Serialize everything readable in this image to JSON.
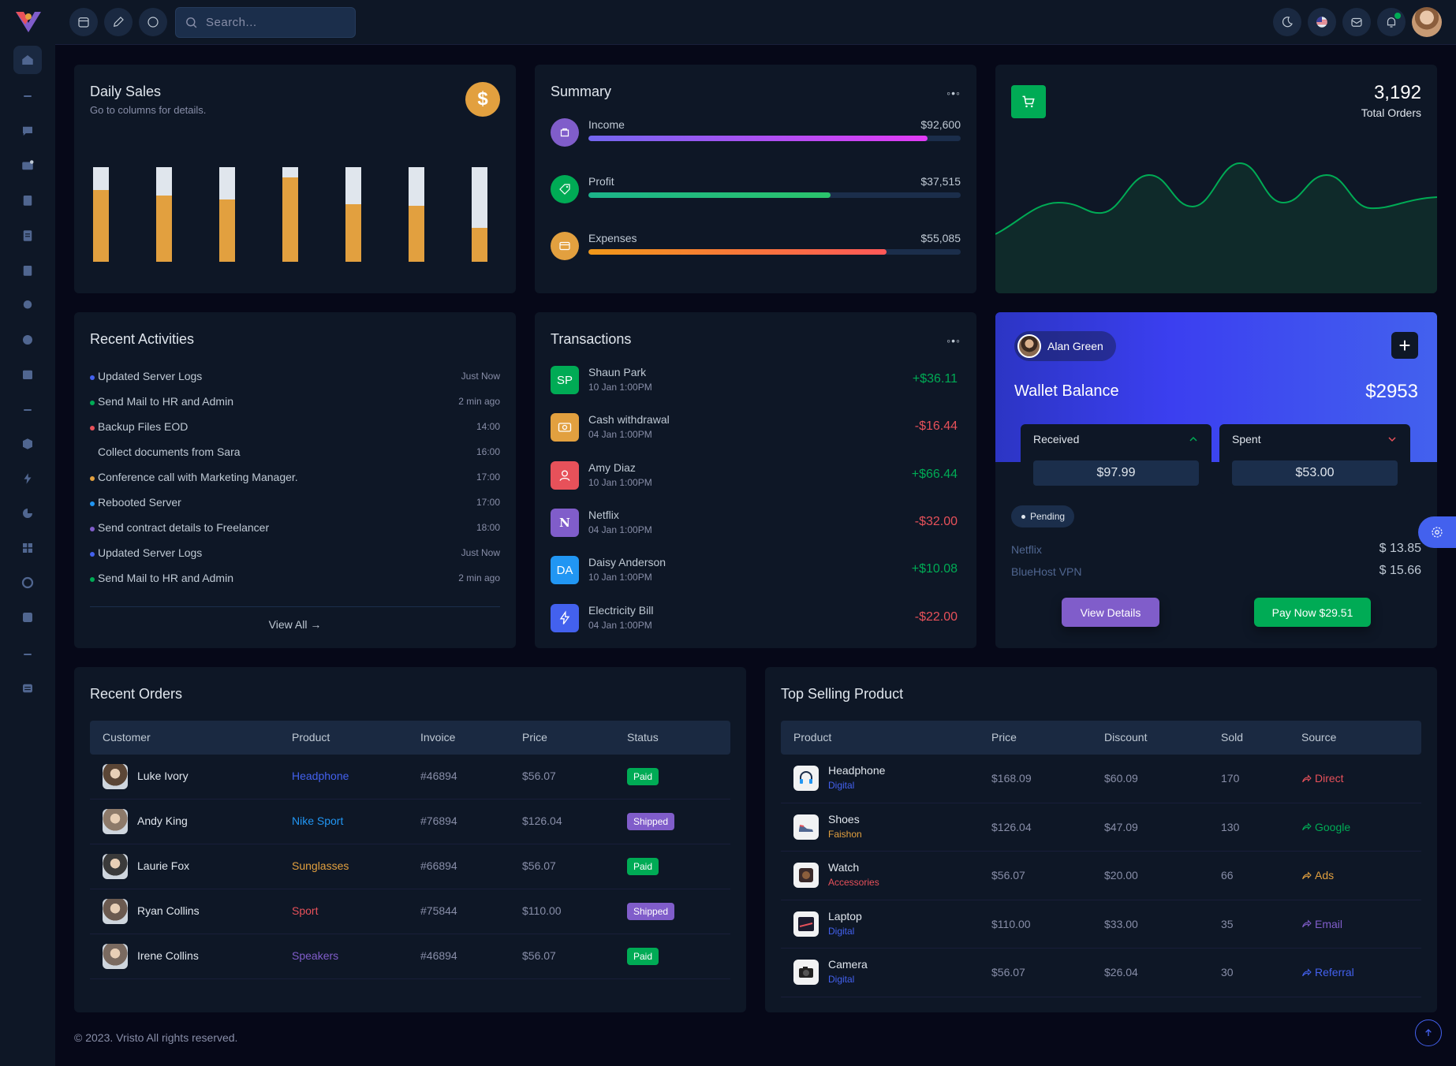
{
  "header": {
    "search_placeholder": "Search..."
  },
  "daily_sales": {
    "title": "Daily Sales",
    "subtitle": "Go to columns for details.",
    "icon_symbol": "$",
    "bars": [
      {
        "sales": 76,
        "last_week": 24
      },
      {
        "sales": 70,
        "last_week": 30
      },
      {
        "sales": 66,
        "last_week": 34
      },
      {
        "sales": 89,
        "last_week": 11
      },
      {
        "sales": 61,
        "last_week": 39
      },
      {
        "sales": 59,
        "last_week": 41
      },
      {
        "sales": 36,
        "last_week": 64
      }
    ],
    "colors": {
      "sales": "#e2a03f",
      "last_week": "#e0e6ed"
    }
  },
  "summary": {
    "title": "Summary",
    "items": [
      {
        "label": "Income",
        "value": "$92,600",
        "percent": 91,
        "icon": "income-icon",
        "icon_bg": "#805dca"
      },
      {
        "label": "Profit",
        "value": "$37,515",
        "percent": 65,
        "icon": "tag-icon",
        "icon_bg": "#00ab55"
      },
      {
        "label": "Expenses",
        "value": "$55,085",
        "percent": 80,
        "icon": "card-icon",
        "icon_bg": "#e2a03f"
      }
    ]
  },
  "total_orders": {
    "value": "3,192",
    "label": "Total Orders"
  },
  "recent_activities": {
    "title": "Recent Activities",
    "view_all": "View All →",
    "items": [
      {
        "text": "Updated Server Logs",
        "time": "Just Now",
        "color": "#4361ee"
      },
      {
        "text": "Send Mail to HR and Admin",
        "time": "2 min ago",
        "color": "#00ab55"
      },
      {
        "text": "Backup Files EOD",
        "time": "14:00",
        "color": "#e7515a"
      },
      {
        "text": "Collect documents from Sara",
        "time": "16:00",
        "color": ""
      },
      {
        "text": "Conference call with Marketing Manager.",
        "time": "17:00",
        "color": "#e2a03f"
      },
      {
        "text": "Rebooted Server",
        "time": "17:00",
        "color": "#2196f3"
      },
      {
        "text": "Send contract details to Freelancer",
        "time": "18:00",
        "color": "#805dca"
      },
      {
        "text": "Updated Server Logs",
        "time": "Just Now",
        "color": "#4361ee"
      },
      {
        "text": "Send Mail to HR and Admin",
        "time": "2 min ago",
        "color": "#00ab55"
      }
    ]
  },
  "transactions": {
    "title": "Transactions",
    "items": [
      {
        "avatar": "SP",
        "name": "Shaun Park",
        "date": "10 Jan 1:00PM",
        "amount": "+$36.11",
        "bg": "#00ab55",
        "positive": true
      },
      {
        "avatar": "",
        "name": "Cash withdrawal",
        "date": "04 Jan 1:00PM",
        "amount": "-$16.44",
        "bg": "#e2a03f",
        "positive": false
      },
      {
        "avatar": "",
        "name": "Amy Diaz",
        "date": "10 Jan 1:00PM",
        "amount": "+$66.44",
        "bg": "#e7515a",
        "positive": true
      },
      {
        "avatar": "N",
        "name": "Netflix",
        "date": "04 Jan 1:00PM",
        "amount": "-$32.00",
        "bg": "#805dca",
        "positive": false
      },
      {
        "avatar": "DA",
        "name": "Daisy Anderson",
        "date": "10 Jan 1:00PM",
        "amount": "+$10.08",
        "bg": "#2196f3",
        "positive": true
      },
      {
        "avatar": "",
        "name": "Electricity Bill",
        "date": "04 Jan 1:00PM",
        "amount": "-$22.00",
        "bg": "#4361ee",
        "positive": false
      }
    ]
  },
  "wallet": {
    "user": "Alan Green",
    "label": "Wallet Balance",
    "balance": "$2953",
    "received_label": "Received",
    "received_value": "$97.99",
    "spent_label": "Spent",
    "spent_value": "$53.00",
    "status": "Pending",
    "items": [
      {
        "name": "Netflix",
        "value": "$ 13.85"
      },
      {
        "name": "BlueHost VPN",
        "value": "$ 15.66"
      }
    ],
    "view_details": "View Details",
    "pay_now": "Pay Now $29.51"
  },
  "recent_orders": {
    "title": "Recent Orders",
    "columns": [
      "Customer",
      "Product",
      "Invoice",
      "Price",
      "Status"
    ],
    "rows": [
      {
        "customer": "Luke Ivory",
        "product": "Headphone",
        "product_color": "#4361ee",
        "invoice": "#46894",
        "price": "$56.07",
        "status": "Paid"
      },
      {
        "customer": "Andy King",
        "product": "Nike Sport",
        "product_color": "#2196f3",
        "invoice": "#76894",
        "price": "$126.04",
        "status": "Shipped"
      },
      {
        "customer": "Laurie Fox",
        "product": "Sunglasses",
        "product_color": "#e2a03f",
        "invoice": "#66894",
        "price": "$56.07",
        "status": "Paid"
      },
      {
        "customer": "Ryan Collins",
        "product": "Sport",
        "product_color": "#e7515a",
        "invoice": "#75844",
        "price": "$110.00",
        "status": "Shipped"
      },
      {
        "customer": "Irene Collins",
        "product": "Speakers",
        "product_color": "#805dca",
        "invoice": "#46894",
        "price": "$56.07",
        "status": "Paid"
      }
    ]
  },
  "top_selling": {
    "title": "Top Selling Product",
    "columns": [
      "Product",
      "Price",
      "Discount",
      "Sold",
      "Source"
    ],
    "rows": [
      {
        "name": "Headphone",
        "category": "Digital",
        "cat_color": "#4361ee",
        "price": "$168.09",
        "discount": "$60.09",
        "sold": "170",
        "source": "Direct",
        "src_color": "#e7515a",
        "icon": "headphone-icon"
      },
      {
        "name": "Shoes",
        "category": "Faishon",
        "cat_color": "#e2a03f",
        "price": "$126.04",
        "discount": "$47.09",
        "sold": "130",
        "source": "Google",
        "src_color": "#00ab55",
        "icon": "shoe-icon"
      },
      {
        "name": "Watch",
        "category": "Accessories",
        "cat_color": "#e7515a",
        "price": "$56.07",
        "discount": "$20.00",
        "sold": "66",
        "source": "Ads",
        "src_color": "#e2a03f",
        "icon": "watch-icon"
      },
      {
        "name": "Laptop",
        "category": "Digital",
        "cat_color": "#4361ee",
        "price": "$110.00",
        "discount": "$33.00",
        "sold": "35",
        "source": "Email",
        "src_color": "#805dca",
        "icon": "laptop-icon"
      },
      {
        "name": "Camera",
        "category": "Digital",
        "cat_color": "#4361ee",
        "price": "$56.07",
        "discount": "$26.04",
        "sold": "30",
        "source": "Referral",
        "src_color": "#4361ee",
        "icon": "camera-icon"
      }
    ]
  },
  "footer": "© 2023. Vristo All rights reserved."
}
